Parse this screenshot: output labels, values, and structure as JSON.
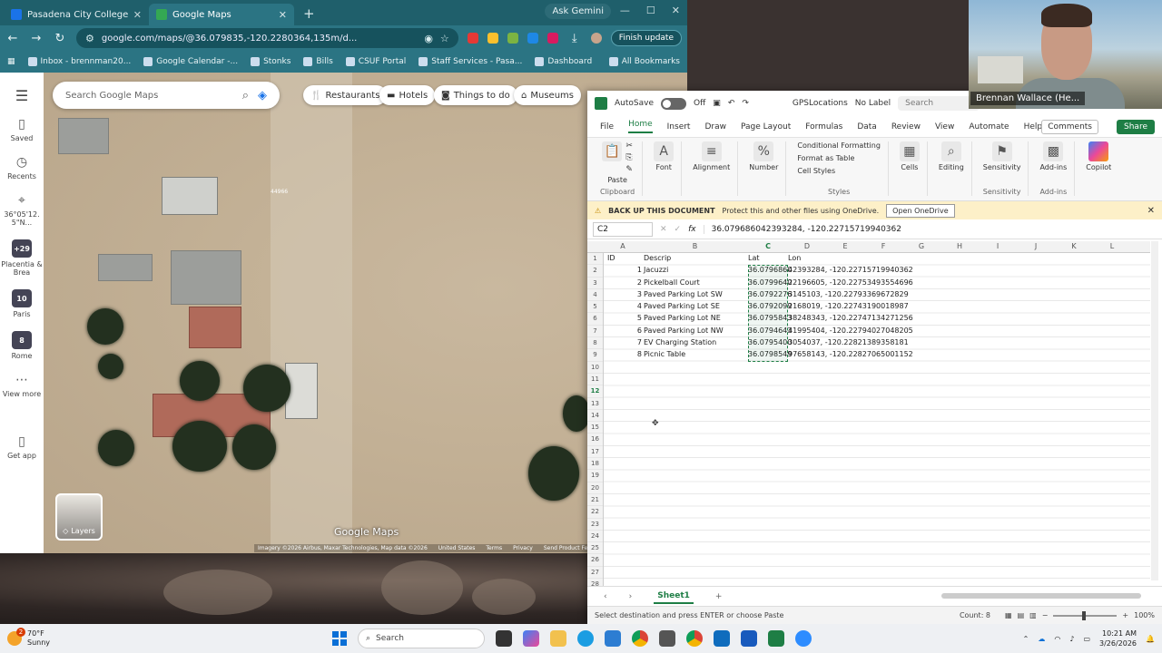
{
  "browser": {
    "tabs": [
      {
        "title": "Pasadena City College - GIS",
        "color": "#1a73e8"
      },
      {
        "title": "Google Maps",
        "color": "#34a853"
      }
    ],
    "gemini": "Ask Gemini",
    "url": "google.com/maps/@36.079835,-120.2280364,135m/d...",
    "update_button": "Finish update",
    "bookmarks": [
      "Inbox - brennman20...",
      "Google Calendar -...",
      "Stonks",
      "Bills",
      "CSUF Portal",
      "Staff Services - Pasa...",
      "Dashboard"
    ],
    "all_bookmarks": "All Bookmarks"
  },
  "maps": {
    "rail": [
      {
        "label": "Saved",
        "icon": "bookmark-icon"
      },
      {
        "label": "Recents",
        "icon": "history-icon"
      },
      {
        "label": "36°05'12. 5\"N...",
        "icon": "pin-icon"
      },
      {
        "label": "Placentia & Brea",
        "badge": "+29"
      },
      {
        "label": "Paris",
        "badge": "10"
      },
      {
        "label": "Rome",
        "badge": "8"
      },
      {
        "label": "View more",
        "icon": "more-icon"
      },
      {
        "label": "Get app",
        "icon": "phone-icon"
      }
    ],
    "search_placeholder": "Search Google Maps",
    "chips": [
      "Restaurants",
      "Hotels",
      "Things to do",
      "Museums"
    ],
    "layers": "Layers",
    "logo": "Google Maps",
    "street_label": "44966",
    "attribution": [
      "Imagery ©2026 Airbus, Maxar Technologies, Map data ©2026",
      "United States",
      "Terms",
      "Privacy",
      "Send Product Feedb"
    ]
  },
  "excel": {
    "autosave": "AutoSave",
    "autosave_state": "Off",
    "filename": "GPSLocations",
    "label": "No Label",
    "search": "Search",
    "menu": [
      "File",
      "Home",
      "Insert",
      "Draw",
      "Page Layout",
      "Formulas",
      "Data",
      "Review",
      "View",
      "Automate",
      "Help"
    ],
    "active_menu": "Home",
    "comments": "Comments",
    "share": "Share",
    "ribbon": {
      "paste": "Paste",
      "clipboard": "Clipboard",
      "font": "Font",
      "alignment": "Alignment",
      "number": "Number",
      "cond_format": "Conditional Formatting",
      "format_table": "Format as Table",
      "cell_styles": "Cell Styles",
      "styles": "Styles",
      "cells": "Cells",
      "editing": "Editing",
      "sensitivity": "Sensitivity",
      "addins": "Add-ins",
      "copilot": "Copilot"
    },
    "notice": {
      "title": "BACK UP THIS DOCUMENT",
      "text": "Protect this and other files using OneDrive.",
      "button": "Open OneDrive"
    },
    "namebox": "C2",
    "formula": "36.079686042393284, -120.22715719940362",
    "columns": [
      "A",
      "B",
      "C",
      "D",
      "E",
      "F",
      "G",
      "H",
      "I",
      "J",
      "K",
      "L"
    ],
    "headers": {
      "id": "ID",
      "descrip": "Descrip",
      "lat": "Lat",
      "lon": "Lon"
    },
    "rows": [
      {
        "id": "1",
        "descrip": "Jacuzzi",
        "lat": "36.0796860",
        "lon": "42393284, -120.22715719940362"
      },
      {
        "id": "2",
        "descrip": "Pickelball Court",
        "lat": "36.0799640",
        "lon": "22196605, -120.22753493554696"
      },
      {
        "id": "3",
        "descrip": "Paved Parking Lot SW",
        "lat": "36.0792276",
        "lon": "3145103, -120.22793369672829"
      },
      {
        "id": "4",
        "descrip": "Paved Parking Lot SE",
        "lat": "36.0792099",
        "lon": "2168019, -120.22743190018987"
      },
      {
        "id": "5",
        "descrip": "Paved Parking Lot NE",
        "lat": "36.0795843",
        "lon": "38248343, -120.22747134271256"
      },
      {
        "id": "6",
        "descrip": "Paved Parking Lot NW",
        "lat": "36.0794643",
        "lon": "41995404, -120.22794027048205"
      },
      {
        "id": "7",
        "descrip": "EV Charging Station",
        "lat": "36.0795400",
        "lon": "3054037, -120.22821389358181"
      },
      {
        "id": "8",
        "descrip": "Picnic Table",
        "lat": "36.0798549",
        "lon": "97658143, -120.22827065001152"
      }
    ],
    "sheet": "Sheet1",
    "status": "Select destination and press ENTER or choose Paste",
    "count": "Count: 8",
    "zoom": "100%"
  },
  "webcam": {
    "name": "Brennan Wallace (He..."
  },
  "taskbar": {
    "temp": "70°F",
    "condition": "Sunny",
    "badge": "2",
    "search": "Search",
    "time": "10:21 AM",
    "date": "3/26/2026"
  }
}
